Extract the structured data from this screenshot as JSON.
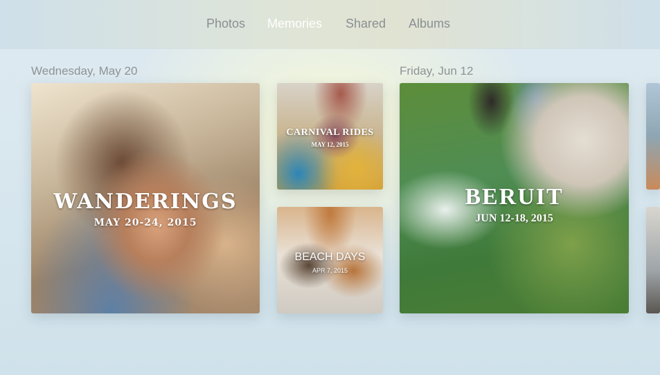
{
  "nav": {
    "tabs": [
      {
        "label": "Photos"
      },
      {
        "label": "Memories"
      },
      {
        "label": "Shared"
      },
      {
        "label": "Albums"
      }
    ],
    "active_tab": "Memories"
  },
  "sections": [
    {
      "date": "Wednesday, May 20"
    },
    {
      "date": "Friday, Jun 12"
    }
  ],
  "memories": {
    "wanderings": {
      "title": "WANDERINGS",
      "dates": "MAY 20-24, 2015"
    },
    "carnival": {
      "title": "CARNIVAL RIDES",
      "dates": "MAY 12, 2015"
    },
    "beach": {
      "title": "BEACH DAYS",
      "dates": "APR 7, 2015"
    },
    "beruit": {
      "title": "BERUIT",
      "dates": "JUN 12-18, 2015"
    }
  },
  "colors": {
    "active_tab": "#ffffff",
    "inactive_tab": "#8a8f93",
    "date_label": "#8d9396"
  }
}
